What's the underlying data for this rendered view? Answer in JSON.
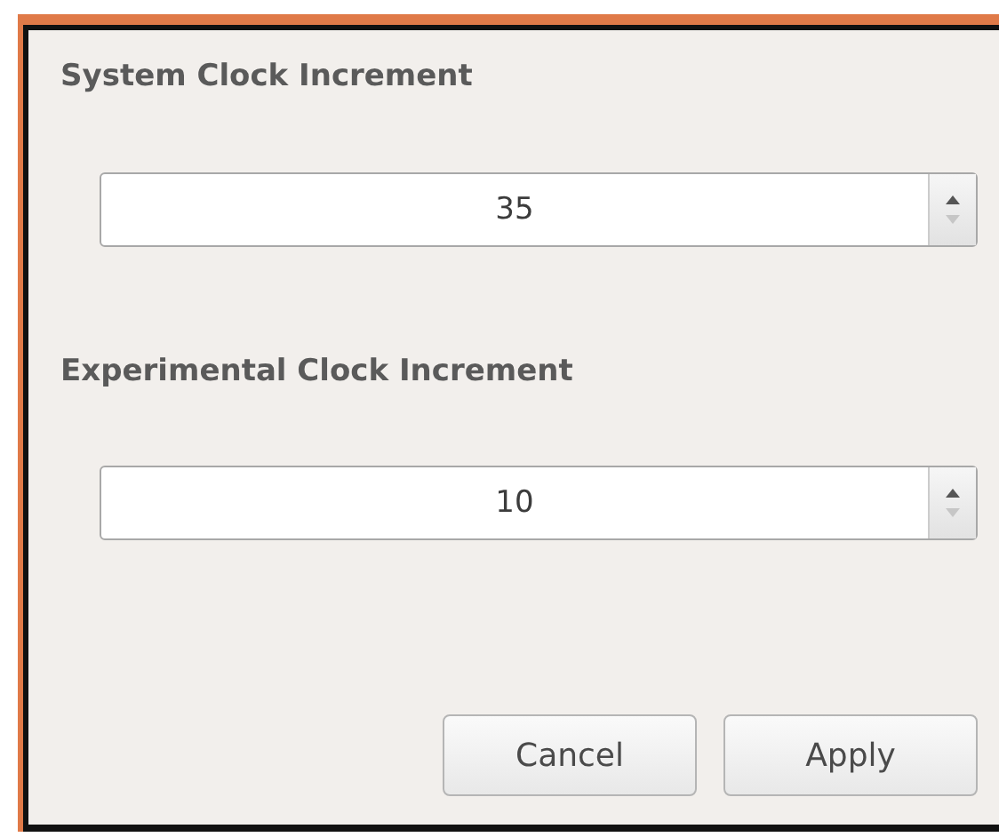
{
  "fields": [
    {
      "label": "System Clock Increment",
      "value": "35",
      "decrement_disabled": true
    },
    {
      "label": "Experimental Clock Increment",
      "value": "10",
      "decrement_disabled": true
    }
  ],
  "buttons": [
    "Cancel",
    "Apply"
  ]
}
